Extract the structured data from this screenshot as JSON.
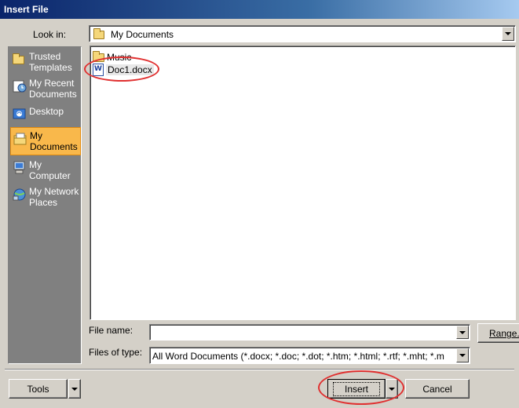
{
  "window": {
    "title": "Insert File"
  },
  "lookin": {
    "label": "Look in:",
    "value": "My Documents"
  },
  "places": [
    {
      "label": "Trusted Templates",
      "icon": "folder-icon"
    },
    {
      "label": "My Recent Documents",
      "icon": "recent-documents-icon"
    },
    {
      "label": "Desktop",
      "icon": "desktop-icon"
    },
    {
      "label": "My Documents",
      "icon": "my-documents-icon",
      "active": true
    },
    {
      "label": "My Computer",
      "icon": "computer-icon"
    },
    {
      "label": "My Network Places",
      "icon": "network-places-icon"
    }
  ],
  "files": [
    {
      "name": "Music",
      "type": "folder"
    },
    {
      "name": "Doc1.docx",
      "type": "word-document"
    }
  ],
  "filename": {
    "label": "File name:",
    "value": ""
  },
  "filetype": {
    "label": "Files of type:",
    "value": "All Word Documents (*.docx; *.doc; *.dot; *.htm; *.html; *.rtf; *.mht; *.m"
  },
  "buttons": {
    "range": "Range...",
    "tools": "Tools",
    "insert": "Insert",
    "cancel": "Cancel"
  },
  "colors": {
    "dialog_bg": "#d4d0c8",
    "title_bar": "#0a246a",
    "active_place": "#f9b84b",
    "annotation": "#e03030"
  }
}
